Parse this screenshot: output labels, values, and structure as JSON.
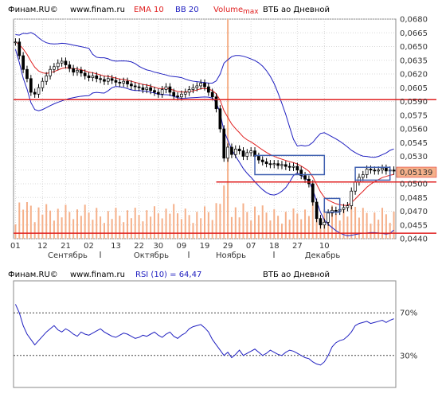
{
  "header": {
    "brand": "Финам.RU©",
    "site": "www.finam.ru",
    "ema_label": "EMA 10",
    "bb_label": "BB 20",
    "volume_label": "Volume",
    "max_label": "max",
    "instrument": "ВТБ ао Дневной"
  },
  "rsi_header": {
    "brand": "Финам.RU©",
    "site": "www.finam.ru",
    "rsi_label": "RSI (10) = 64,47",
    "instrument": "ВТБ ао Дневной"
  },
  "colors": {
    "background": "#ffffff",
    "plot_bg": "#ffffff",
    "grid": "#d8d8d8",
    "candle": "#000000",
    "ema": "#e02020",
    "bb": "#2020c0",
    "volume": "#f5b08a",
    "support": "#e02020",
    "box": "#4060b0",
    "rsi": "#2020c0",
    "price_tag_bg": "#f5b08a"
  },
  "chart_data": [
    {
      "type": "candlestick",
      "title": "ВТБ ао Дневной",
      "ylim": [
        0.044,
        0.068
      ],
      "y_ticks": [
        "0,0680",
        "0,0665",
        "0,0650",
        "0,0635",
        "0,0620",
        "0,0605",
        "0,0590",
        "0,0575",
        "0,0560",
        "0,0545",
        "0,0530",
        "0,0515",
        "0,0500",
        "0,0485",
        "0,0470",
        "0,0455",
        "0,0440"
      ],
      "x_ticks": [
        "01",
        "12",
        "21",
        "02",
        "13",
        "22",
        "30",
        "09",
        "19",
        "29",
        "07",
        "18",
        "27",
        "10"
      ],
      "months": [
        "Сентябрь",
        "Октябрь",
        "Ноябрь",
        "Декабрь"
      ],
      "last_price_label": "0,05139",
      "closes": [
        0.0655,
        0.064,
        0.0625,
        0.0615,
        0.06,
        0.0598,
        0.0605,
        0.0612,
        0.0618,
        0.0625,
        0.0628,
        0.0632,
        0.0634,
        0.063,
        0.0626,
        0.0622,
        0.0624,
        0.0621,
        0.0618,
        0.0616,
        0.0618,
        0.0615,
        0.0614,
        0.0612,
        0.0615,
        0.0613,
        0.0611,
        0.061,
        0.0612,
        0.0609,
        0.0607,
        0.0606,
        0.0605,
        0.0603,
        0.0605,
        0.0602,
        0.06,
        0.0598,
        0.0603,
        0.0606,
        0.06,
        0.0596,
        0.0595,
        0.0598,
        0.06,
        0.0603,
        0.0605,
        0.0607,
        0.061,
        0.0606,
        0.06,
        0.0595,
        0.0582,
        0.056,
        0.0528,
        0.054,
        0.0532,
        0.0538,
        0.0536,
        0.053,
        0.0534,
        0.0536,
        0.053,
        0.0526,
        0.0524,
        0.0522,
        0.0521,
        0.0522,
        0.052,
        0.0521,
        0.0519,
        0.0518,
        0.0519,
        0.0515,
        0.0509,
        0.0505,
        0.05,
        0.048,
        0.0462,
        0.0455,
        0.0458,
        0.0468,
        0.0471,
        0.047,
        0.0472,
        0.0474,
        0.0476,
        0.0492,
        0.0502,
        0.0507,
        0.051,
        0.0516,
        0.0515,
        0.0514,
        0.0515,
        0.0517,
        0.0514,
        0.0515,
        0.05139
      ],
      "horizontal_lines": [
        0.0592,
        0.0502,
        0.0446
      ],
      "boxes": [
        {
          "x0": 62,
          "x1": 80,
          "y0": 0.0531,
          "y1": 0.051
        },
        {
          "x0": 80,
          "x1": 84,
          "y0": 0.0484,
          "y1": 0.0469
        },
        {
          "x0": 88,
          "x1": 97,
          "y0": 0.0518,
          "y1": 0.0504
        }
      ],
      "volume_max_index": 55
    },
    {
      "type": "line",
      "title": "RSI (10) = 64,47",
      "ylim": [
        0,
        100
      ],
      "levels": [
        70,
        30
      ],
      "level_labels": [
        "70%",
        "30%"
      ],
      "values": [
        78,
        70,
        58,
        50,
        45,
        40,
        44,
        48,
        52,
        55,
        58,
        54,
        52,
        55,
        53,
        50,
        48,
        52,
        50,
        49,
        51,
        53,
        55,
        52,
        50,
        48,
        47,
        49,
        51,
        50,
        48,
        46,
        47,
        49,
        48,
        50,
        52,
        49,
        47,
        50,
        52,
        48,
        46,
        49,
        51,
        55,
        57,
        58,
        59,
        56,
        52,
        45,
        40,
        35,
        30,
        33,
        28,
        31,
        35,
        30,
        32,
        34,
        36,
        33,
        30,
        32,
        35,
        33,
        31,
        30,
        33,
        35,
        34,
        32,
        30,
        28,
        27,
        24,
        22,
        21,
        24,
        30,
        38,
        42,
        44,
        45,
        48,
        52,
        58,
        60,
        61,
        62,
        60,
        61,
        62,
        63,
        61,
        63,
        64.47
      ]
    }
  ]
}
